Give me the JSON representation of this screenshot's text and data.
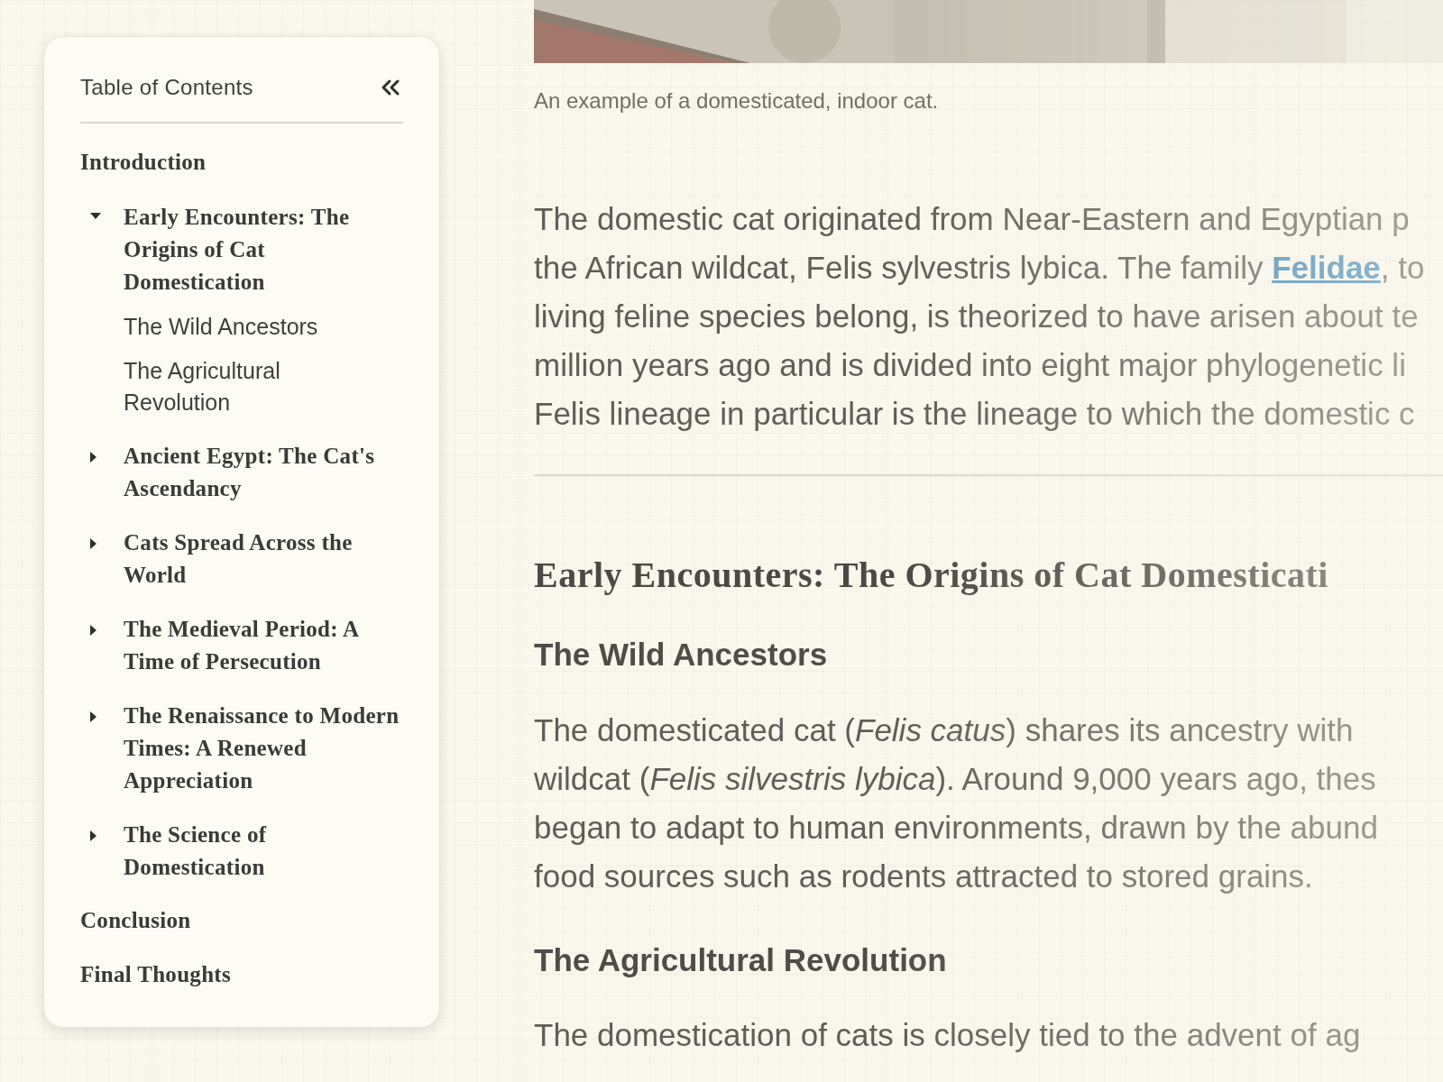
{
  "toc": {
    "title": "Table of Contents",
    "items": [
      {
        "label": "Introduction",
        "kind": "top"
      },
      {
        "label": "Early Encounters: The Origins of Cat Domestication",
        "kind": "section",
        "expanded": true,
        "children": [
          {
            "label": "The Wild Ancestors"
          },
          {
            "label": "The Agricultural Revolution"
          }
        ]
      },
      {
        "label": "Ancient Egypt: The Cat's Ascendancy",
        "kind": "section",
        "expanded": false
      },
      {
        "label": "Cats Spread Across the World",
        "kind": "section",
        "expanded": false
      },
      {
        "label": "The Medieval Period: A Time of Persecution",
        "kind": "section",
        "expanded": false
      },
      {
        "label": "The Renaissance to Modern Times: A Renewed Appreciation",
        "kind": "section",
        "expanded": false
      },
      {
        "label": "The Science of Domestication",
        "kind": "section",
        "expanded": false
      },
      {
        "label": "Conclusion",
        "kind": "top"
      },
      {
        "label": "Final Thoughts",
        "kind": "top"
      }
    ]
  },
  "article": {
    "figure": {
      "kind": "picture",
      "caption": "An example of a domesticated, indoor cat."
    },
    "blocks": [
      {
        "kind": "paragraph",
        "lines": [
          [
            {
              "text": "The domestic cat originated from Near-Eastern and Egyptian p",
              "kind": "plain"
            }
          ],
          [
            {
              "text": "the African wildcat, Felis sylvestris lybica. The family ",
              "kind": "plain"
            },
            {
              "text": "Felidae",
              "kind": "link"
            },
            {
              "text": ", to",
              "kind": "plain"
            }
          ],
          [
            {
              "text": "living feline species belong, is theorized to have arisen about te",
              "kind": "plain"
            }
          ],
          [
            {
              "text": "million years ago and is divided into eight major phylogenetic li",
              "kind": "plain"
            }
          ],
          [
            {
              "text": "Felis lineage in particular is the lineage to which the domestic c",
              "kind": "plain"
            }
          ]
        ]
      },
      {
        "kind": "rule"
      },
      {
        "kind": "heading",
        "text": "Early Encounters: The Origins of Cat Domesticati"
      },
      {
        "kind": "subheading",
        "text": "The Wild Ancestors"
      },
      {
        "kind": "paragraph",
        "lines": [
          [
            {
              "text": "The domesticated cat (*Felis catus*) shares its ancestry with",
              "kind": "plain"
            }
          ],
          [
            {
              "text": "wildcat (*Felis silvestris lybica*). Around 9,000 years ago, thes",
              "kind": "plain"
            }
          ],
          [
            {
              "text": "began to adapt to human environments, drawn by the abund",
              "kind": "plain"
            }
          ],
          [
            {
              "text": "food sources such as rodents attracted to stored grains.",
              "kind": "plain"
            }
          ]
        ]
      },
      {
        "kind": "subheading",
        "text": "The Agricultural Revolution"
      },
      {
        "kind": "paragraph",
        "lines": [
          [
            {
              "text": "The domestication of cats is closely tied to the advent of ag",
              "kind": "plain"
            }
          ]
        ]
      }
    ]
  }
}
